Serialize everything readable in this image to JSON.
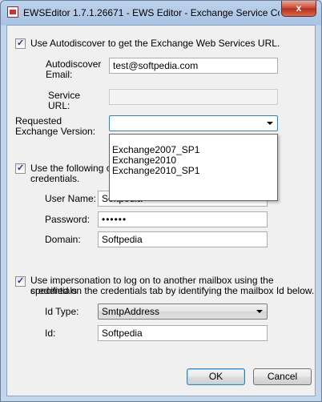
{
  "window": {
    "title": "EWSEditor 1.7.1.26671 - EWS Editor - Exchange Service Co...",
    "close_glyph": "x"
  },
  "autodiscover": {
    "checked": true,
    "label": "Use Autodiscover to get the Exchange Web Services URL.",
    "email_label_1": "Autodiscover",
    "email_label_2": "Email:",
    "email_value": "test@softpedia.com",
    "url_label_1": "Service",
    "url_label_2": "URL:",
    "url_value": ""
  },
  "version": {
    "label_1": "Requested",
    "label_2": "Exchange Version:",
    "selected": "",
    "options": [
      "Exchange2007_SP1",
      "Exchange2010",
      "Exchange2010_SP1"
    ]
  },
  "credentials": {
    "checked": true,
    "label_1": "Use the following cre",
    "label_2": "credentials.",
    "user_label": "User Name:",
    "user_value": "Softpedia",
    "password_label": "Password:",
    "password_value": "••••••",
    "domain_label": "Domain:",
    "domain_value": "Softpedia"
  },
  "impersonation": {
    "checked": true,
    "label_1": "Use impersonation to log on to another mailbox using the credentials",
    "label_2": "specified on the credentials tab by identifying the mailbox Id below.",
    "idtype_label": "Id Type:",
    "idtype_value": "SmtpAddress",
    "id_label": "Id:",
    "id_value": "Softpedia"
  },
  "buttons": {
    "ok": "OK",
    "cancel": "Cancel"
  },
  "check_glyph": "✓"
}
